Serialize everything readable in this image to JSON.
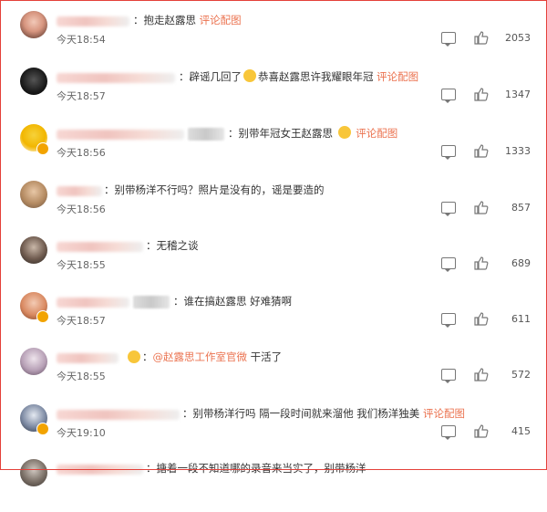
{
  "comments": [
    {
      "parts": [
        {
          "t": "：抱走赵露思 ",
          "c": "text"
        },
        {
          "t": "评论配图",
          "c": "link"
        }
      ],
      "time": "今天18:54",
      "likes": "2053"
    },
    {
      "parts": [
        {
          "t": "：辟谣几回了",
          "c": "text"
        },
        {
          "emoji": true
        },
        {
          "t": "恭喜赵露思许我耀眼年冠 ",
          "c": "text"
        },
        {
          "t": "评论配图",
          "c": "link"
        }
      ],
      "time": "今天18:57",
      "likes": "1347"
    },
    {
      "parts": [
        {
          "t": "：别带年冠女王赵露思 ",
          "c": "text"
        },
        {
          "emoji": true
        },
        {
          "t": " 评论配图",
          "c": "link"
        }
      ],
      "time": "今天18:56",
      "likes": "1333"
    },
    {
      "parts": [
        {
          "t": "：别带杨洋不行吗？照片是没有的，谣是要造的",
          "c": "text"
        }
      ],
      "time": "今天18:56",
      "likes": "857"
    },
    {
      "parts": [
        {
          "t": "：无稽之谈",
          "c": "text"
        }
      ],
      "time": "今天18:55",
      "likes": "689"
    },
    {
      "parts": [
        {
          "t": "：谁在搞赵露思 好难猜啊",
          "c": "text"
        }
      ],
      "time": "今天18:57",
      "likes": "611"
    },
    {
      "parts": [
        {
          "t": "：",
          "c": "text"
        },
        {
          "t": "@赵露思工作室官微",
          "c": "mention"
        },
        {
          "t": " 干活了",
          "c": "text"
        }
      ],
      "time": "今天18:55",
      "likes": "572"
    },
    {
      "parts": [
        {
          "t": "：别带杨洋行吗 隔一段时间就来溜他 我们杨洋独美 ",
          "c": "text"
        },
        {
          "t": "评论配图",
          "c": "link"
        }
      ],
      "time": "今天19:10",
      "likes": "415"
    },
    {
      "parts": [
        {
          "t": "：搪着一段不知道哪的录音来当实了，别带杨洋",
          "c": "text"
        }
      ],
      "time": "",
      "likes": ""
    }
  ],
  "icons": {
    "reply": "comment-reply-icon",
    "like": "thumbs-up-icon"
  },
  "colors": {
    "link": "#eb7350",
    "frame": "#e4403a",
    "text": "#333333",
    "meta": "#666666"
  }
}
